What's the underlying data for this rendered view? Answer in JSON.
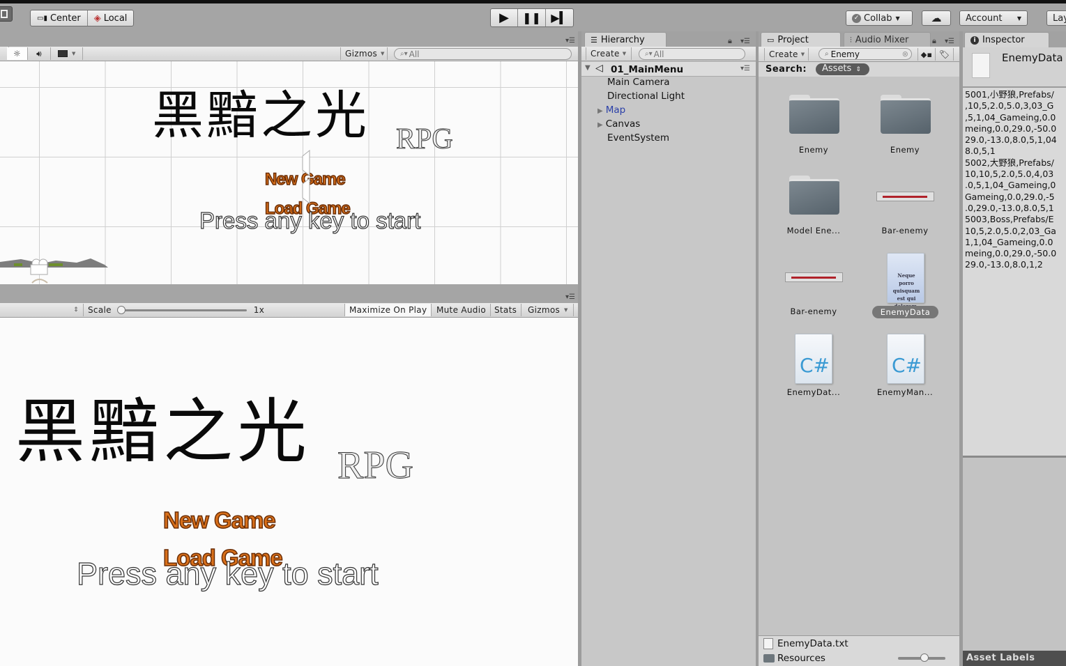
{
  "toolbar": {
    "pivot_center": "Center",
    "pivot_local": "Local",
    "play_icon": "play-icon",
    "pause_icon": "pause-icon",
    "step_icon": "step-icon",
    "collab": "Collab",
    "cloud_icon": "cloud-icon",
    "account": "Account",
    "layers": "Lay"
  },
  "scene": {
    "gizmos": "Gizmos",
    "search_placeholder": "All",
    "title_cn": "黑黯之光",
    "title_rpg": "RPG",
    "new_game": "New Game",
    "load_game": "Load Game",
    "press_any_key": "Press any key to start"
  },
  "game": {
    "scale_label": "Scale",
    "scale_value": "1x",
    "maximize_on_play": "Maximize On Play",
    "mute_audio": "Mute Audio",
    "stats": "Stats",
    "gizmos": "Gizmos",
    "title_cn": "黑黯之光",
    "title_rpg": "RPG",
    "new_game": "New Game",
    "load_game": "Load Game",
    "press_any_key": "Press any key to start"
  },
  "hierarchy": {
    "tab": "Hierarchy",
    "create": "Create",
    "search_placeholder": "All",
    "scene_name": "01_MainMenu",
    "items": [
      {
        "label": "Main Camera",
        "expandable": false
      },
      {
        "label": "Directional Light",
        "expandable": false
      },
      {
        "label": "Map",
        "expandable": true,
        "highlight": "#2a3fa8"
      },
      {
        "label": "Canvas",
        "expandable": true
      },
      {
        "label": "EventSystem",
        "expandable": false
      }
    ]
  },
  "project": {
    "tab": "Project",
    "tab_audio": "Audio Mixer",
    "create": "Create",
    "search_value": "Enemy",
    "search_label": "Search:",
    "search_scope": "Assets",
    "assets": [
      {
        "label": "Enemy",
        "type": "folder"
      },
      {
        "label": "Enemy",
        "type": "folder"
      },
      {
        "label": "Model Ene...",
        "type": "folder"
      },
      {
        "label": "Bar-enemy",
        "type": "sprite"
      },
      {
        "label": "Bar-enemy",
        "type": "sprite"
      },
      {
        "label": "EnemyData",
        "type": "text",
        "selected": true
      },
      {
        "label": "EnemyDat...",
        "type": "script"
      },
      {
        "label": "EnemyMan...",
        "type": "script"
      }
    ],
    "footer_file": "EnemyData.txt",
    "footer_folder": "Resources",
    "doc_preview": "Neque porro quisquam est qui dolorem."
  },
  "inspector": {
    "tab": "Inspector",
    "asset_name": "EnemyData",
    "content": "5001,小野狼,Prefabs/\n,10,5,2.0,5.0,3,03_G\n,5,1,04_Gameing,0.0\nmeing,0.0,29.0,-50.0\n29.0,-13.0,8.0,5,1,04\n8.0,5,1\n5002,大野狼,Prefabs/\n10,10,5,2.0,5.0,4,03\n.0,5,1,04_Gameing,0\nGameing,0.0,29.0,-5\n.0,29.0,-13.0,8.0,5,1\n5003,Boss,Prefabs/E\n10,5,2.0,5.0,2,03_Ga\n1,1,04_Gameing,0.0\nmeing,0.0,29.0,-50.0\n29.0,-13.0,8.0,1,2",
    "asset_labels": "Asset Labels"
  }
}
